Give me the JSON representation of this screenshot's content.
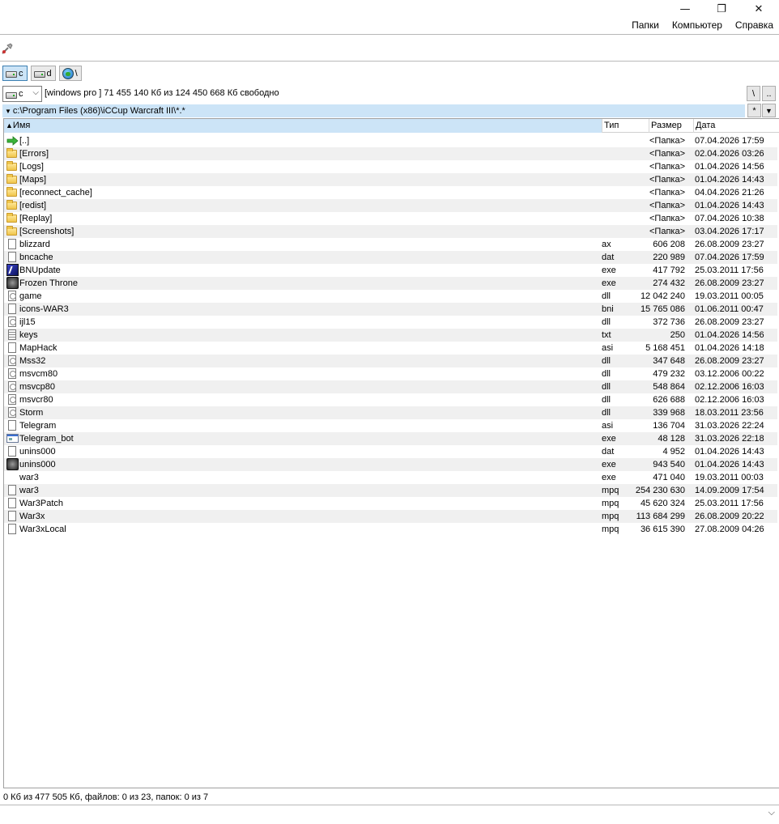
{
  "window": {
    "minimize_glyph": "—",
    "restore_glyph": "❐",
    "close_glyph": "✕"
  },
  "menu": {
    "items": [
      "Папки",
      "Компьютер",
      "Справка"
    ]
  },
  "drives": [
    {
      "label": "c",
      "icon": "disk-icon",
      "active": true
    },
    {
      "label": "d",
      "icon": "disk-icon",
      "active": false
    },
    {
      "label": "\\",
      "icon": "network-globe-icon",
      "active": false
    }
  ],
  "drive_select": {
    "value": "c"
  },
  "drive_info": "[windows pro ]  71 455 140 Кб из 124 450 668 Кб свободно",
  "nav_buttons": {
    "root": "\\",
    "up": ".."
  },
  "current_path": "c:\\Program Files (x86)\\iCCup Warcraft III\\*.*",
  "path_buttons": {
    "history": "*",
    "hotlist": "▼"
  },
  "columns": {
    "name": "Имя",
    "ext": "Тип",
    "size": "Размер",
    "date": "Дата"
  },
  "sort_indicator": "🡅",
  "files": [
    {
      "name": "[..]",
      "ext": "",
      "size": "<Папка>",
      "date": "07.04.2026 17:59",
      "icon": "up-arrow-icon"
    },
    {
      "name": "[Errors]",
      "ext": "",
      "size": "<Папка>",
      "date": "02.04.2026 03:26",
      "icon": "folder-icon"
    },
    {
      "name": "[Logs]",
      "ext": "",
      "size": "<Папка>",
      "date": "01.04.2026 14:56",
      "icon": "folder-icon"
    },
    {
      "name": "[Maps]",
      "ext": "",
      "size": "<Папка>",
      "date": "01.04.2026 14:43",
      "icon": "folder-icon"
    },
    {
      "name": "[reconnect_cache]",
      "ext": "",
      "size": "<Папка>",
      "date": "04.04.2026 21:26",
      "icon": "folder-icon"
    },
    {
      "name": "[redist]",
      "ext": "",
      "size": "<Папка>",
      "date": "01.04.2026 14:43",
      "icon": "folder-icon"
    },
    {
      "name": "[Replay]",
      "ext": "",
      "size": "<Папка>",
      "date": "07.04.2026 10:38",
      "icon": "folder-icon"
    },
    {
      "name": "[Screenshots]",
      "ext": "",
      "size": "<Папка>",
      "date": "03.04.2026 17:17",
      "icon": "folder-icon"
    },
    {
      "name": "blizzard",
      "ext": "ax",
      "size": "606 208",
      "date": "26.08.2009 23:27",
      "icon": "file-icon"
    },
    {
      "name": "bncache",
      "ext": "dat",
      "size": "220 989",
      "date": "07.04.2026 17:59",
      "icon": "file-icon"
    },
    {
      "name": "BNUpdate",
      "ext": "exe",
      "size": "417 792",
      "date": "25.03.2011 17:56",
      "icon": "bnupdate-exe-icon"
    },
    {
      "name": "Frozen Throne",
      "ext": "exe",
      "size": "274 432",
      "date": "26.08.2009 23:27",
      "icon": "frozen-throne-exe-icon"
    },
    {
      "name": "game",
      "ext": "dll",
      "size": "12 042 240",
      "date": "19.03.2011 00:05",
      "icon": "dll-icon"
    },
    {
      "name": "icons-WAR3",
      "ext": "bni",
      "size": "15 765 086",
      "date": "01.06.2011 00:47",
      "icon": "file-icon"
    },
    {
      "name": "ijl15",
      "ext": "dll",
      "size": "372 736",
      "date": "26.08.2009 23:27",
      "icon": "dll-icon"
    },
    {
      "name": "keys",
      "ext": "txt",
      "size": "250",
      "date": "01.04.2026 14:56",
      "icon": "text-file-icon"
    },
    {
      "name": "MapHack",
      "ext": "asi",
      "size": "5 168 451",
      "date": "01.04.2026 14:18",
      "icon": "file-icon"
    },
    {
      "name": "Mss32",
      "ext": "dll",
      "size": "347 648",
      "date": "26.08.2009 23:27",
      "icon": "dll-icon"
    },
    {
      "name": "msvcm80",
      "ext": "dll",
      "size": "479 232",
      "date": "03.12.2006 00:22",
      "icon": "dll-icon"
    },
    {
      "name": "msvcp80",
      "ext": "dll",
      "size": "548 864",
      "date": "02.12.2006 16:03",
      "icon": "dll-icon"
    },
    {
      "name": "msvcr80",
      "ext": "dll",
      "size": "626 688",
      "date": "02.12.2006 16:03",
      "icon": "dll-icon"
    },
    {
      "name": "Storm",
      "ext": "dll",
      "size": "339 968",
      "date": "18.03.2011 23:56",
      "icon": "dll-icon"
    },
    {
      "name": "Telegram",
      "ext": "asi",
      "size": "136 704",
      "date": "31.03.2026 22:24",
      "icon": "file-icon"
    },
    {
      "name": "Telegram_bot",
      "ext": "exe",
      "size": "48 128",
      "date": "31.03.2026 22:18",
      "icon": "window-exe-icon"
    },
    {
      "name": "unins000",
      "ext": "dat",
      "size": "4 952",
      "date": "01.04.2026 14:43",
      "icon": "file-icon"
    },
    {
      "name": "unins000",
      "ext": "exe",
      "size": "943 540",
      "date": "01.04.2026 14:43",
      "icon": "uninstaller-exe-icon"
    },
    {
      "name": "war3",
      "ext": "exe",
      "size": "471 040",
      "date": "19.03.2011 00:03",
      "icon": "blank-icon"
    },
    {
      "name": "war3",
      "ext": "mpq",
      "size": "254 230 630",
      "date": "14.09.2009 17:54",
      "icon": "file-icon"
    },
    {
      "name": "War3Patch",
      "ext": "mpq",
      "size": "45 620 324",
      "date": "25.03.2011 17:56",
      "icon": "file-icon"
    },
    {
      "name": "War3x",
      "ext": "mpq",
      "size": "113 684 299",
      "date": "26.08.2009 20:22",
      "icon": "file-icon"
    },
    {
      "name": "War3xLocal",
      "ext": "mpq",
      "size": "36 615 390",
      "date": "27.08.2009 04:26",
      "icon": "file-icon"
    }
  ],
  "status": "0 Кб из 477 505 Кб, файлов: 0 из 23, папок: 0 из 7",
  "command_line": {
    "value": "",
    "chevron": "⌵"
  }
}
